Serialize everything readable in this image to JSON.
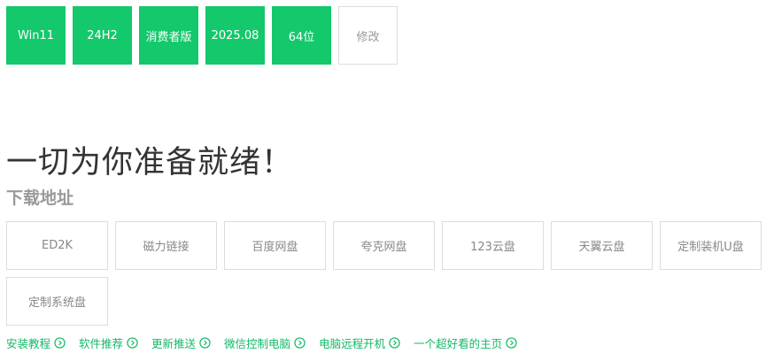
{
  "options": [
    {
      "label": "Win11",
      "selected": true
    },
    {
      "label": "24H2",
      "selected": true
    },
    {
      "label": "消费者版",
      "selected": true
    },
    {
      "label": "2025.08",
      "selected": true
    },
    {
      "label": "64位",
      "selected": true
    },
    {
      "label": "修改",
      "selected": false
    }
  ],
  "headline": "一切为你准备就绪！",
  "subtitle": "下载地址",
  "downloads": [
    "ED2K",
    "磁力链接",
    "百度网盘",
    "夸克网盘",
    "123云盘",
    "天翼云盘",
    "定制装机U盘",
    "定制系统盘"
  ],
  "links": [
    "安装教程",
    "软件推荐",
    "更新推送",
    "微信控制电脑",
    "电脑远程开机",
    "一个超好看的主页"
  ],
  "colors": {
    "accent": "#14c86c",
    "link": "#14b866",
    "border": "#dddddd",
    "muted": "#999999"
  },
  "icons": {
    "link_arrow": "chevron-right-circle-icon"
  }
}
